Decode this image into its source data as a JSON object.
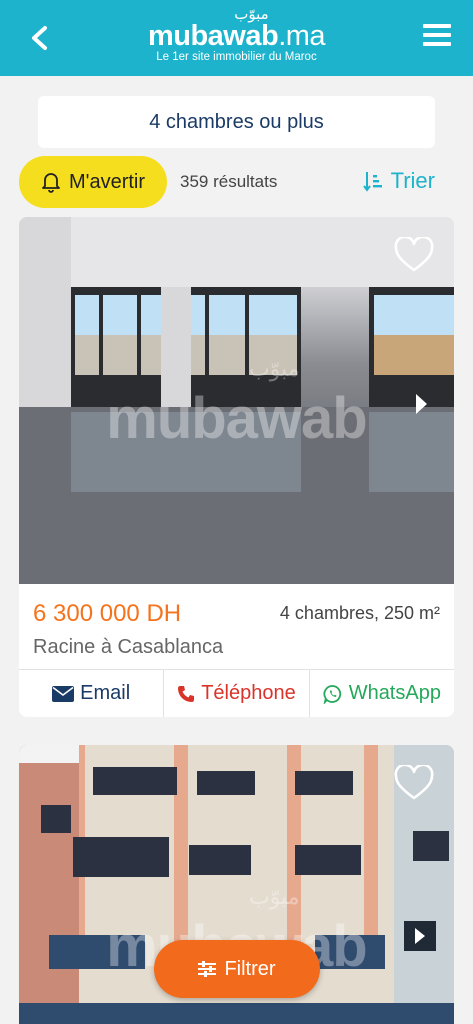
{
  "header": {
    "logo_arabic": "مبوّب",
    "logo_name": "mubawab",
    "logo_tld": ".ma",
    "tagline": "Le 1er site immobilier du Maroc"
  },
  "filter_chip": {
    "label": "4 chambres ou plus"
  },
  "toolbar": {
    "alert_label": "M'avertir",
    "results_label": "359 résultats",
    "sort_label": "Trier"
  },
  "listings": [
    {
      "price": "6 300 000 DH",
      "details": "4 chambres, 250 m²",
      "location": "Racine à Casablanca",
      "email_label": "Email",
      "phone_label": "Téléphone",
      "whatsapp_label": "WhatsApp",
      "watermark": "mubawab",
      "watermark_arabic": "مبوّب"
    },
    {
      "watermark": "mubawab",
      "watermark_arabic": "مبوّب"
    }
  ],
  "fab": {
    "label": "Filtrer"
  },
  "colors": {
    "header": "#1eb3cc",
    "alert": "#f5de1d",
    "price": "#f4731c",
    "fab": "#f26a1b",
    "whatsapp": "#25a85a",
    "phone": "#d8342a"
  }
}
